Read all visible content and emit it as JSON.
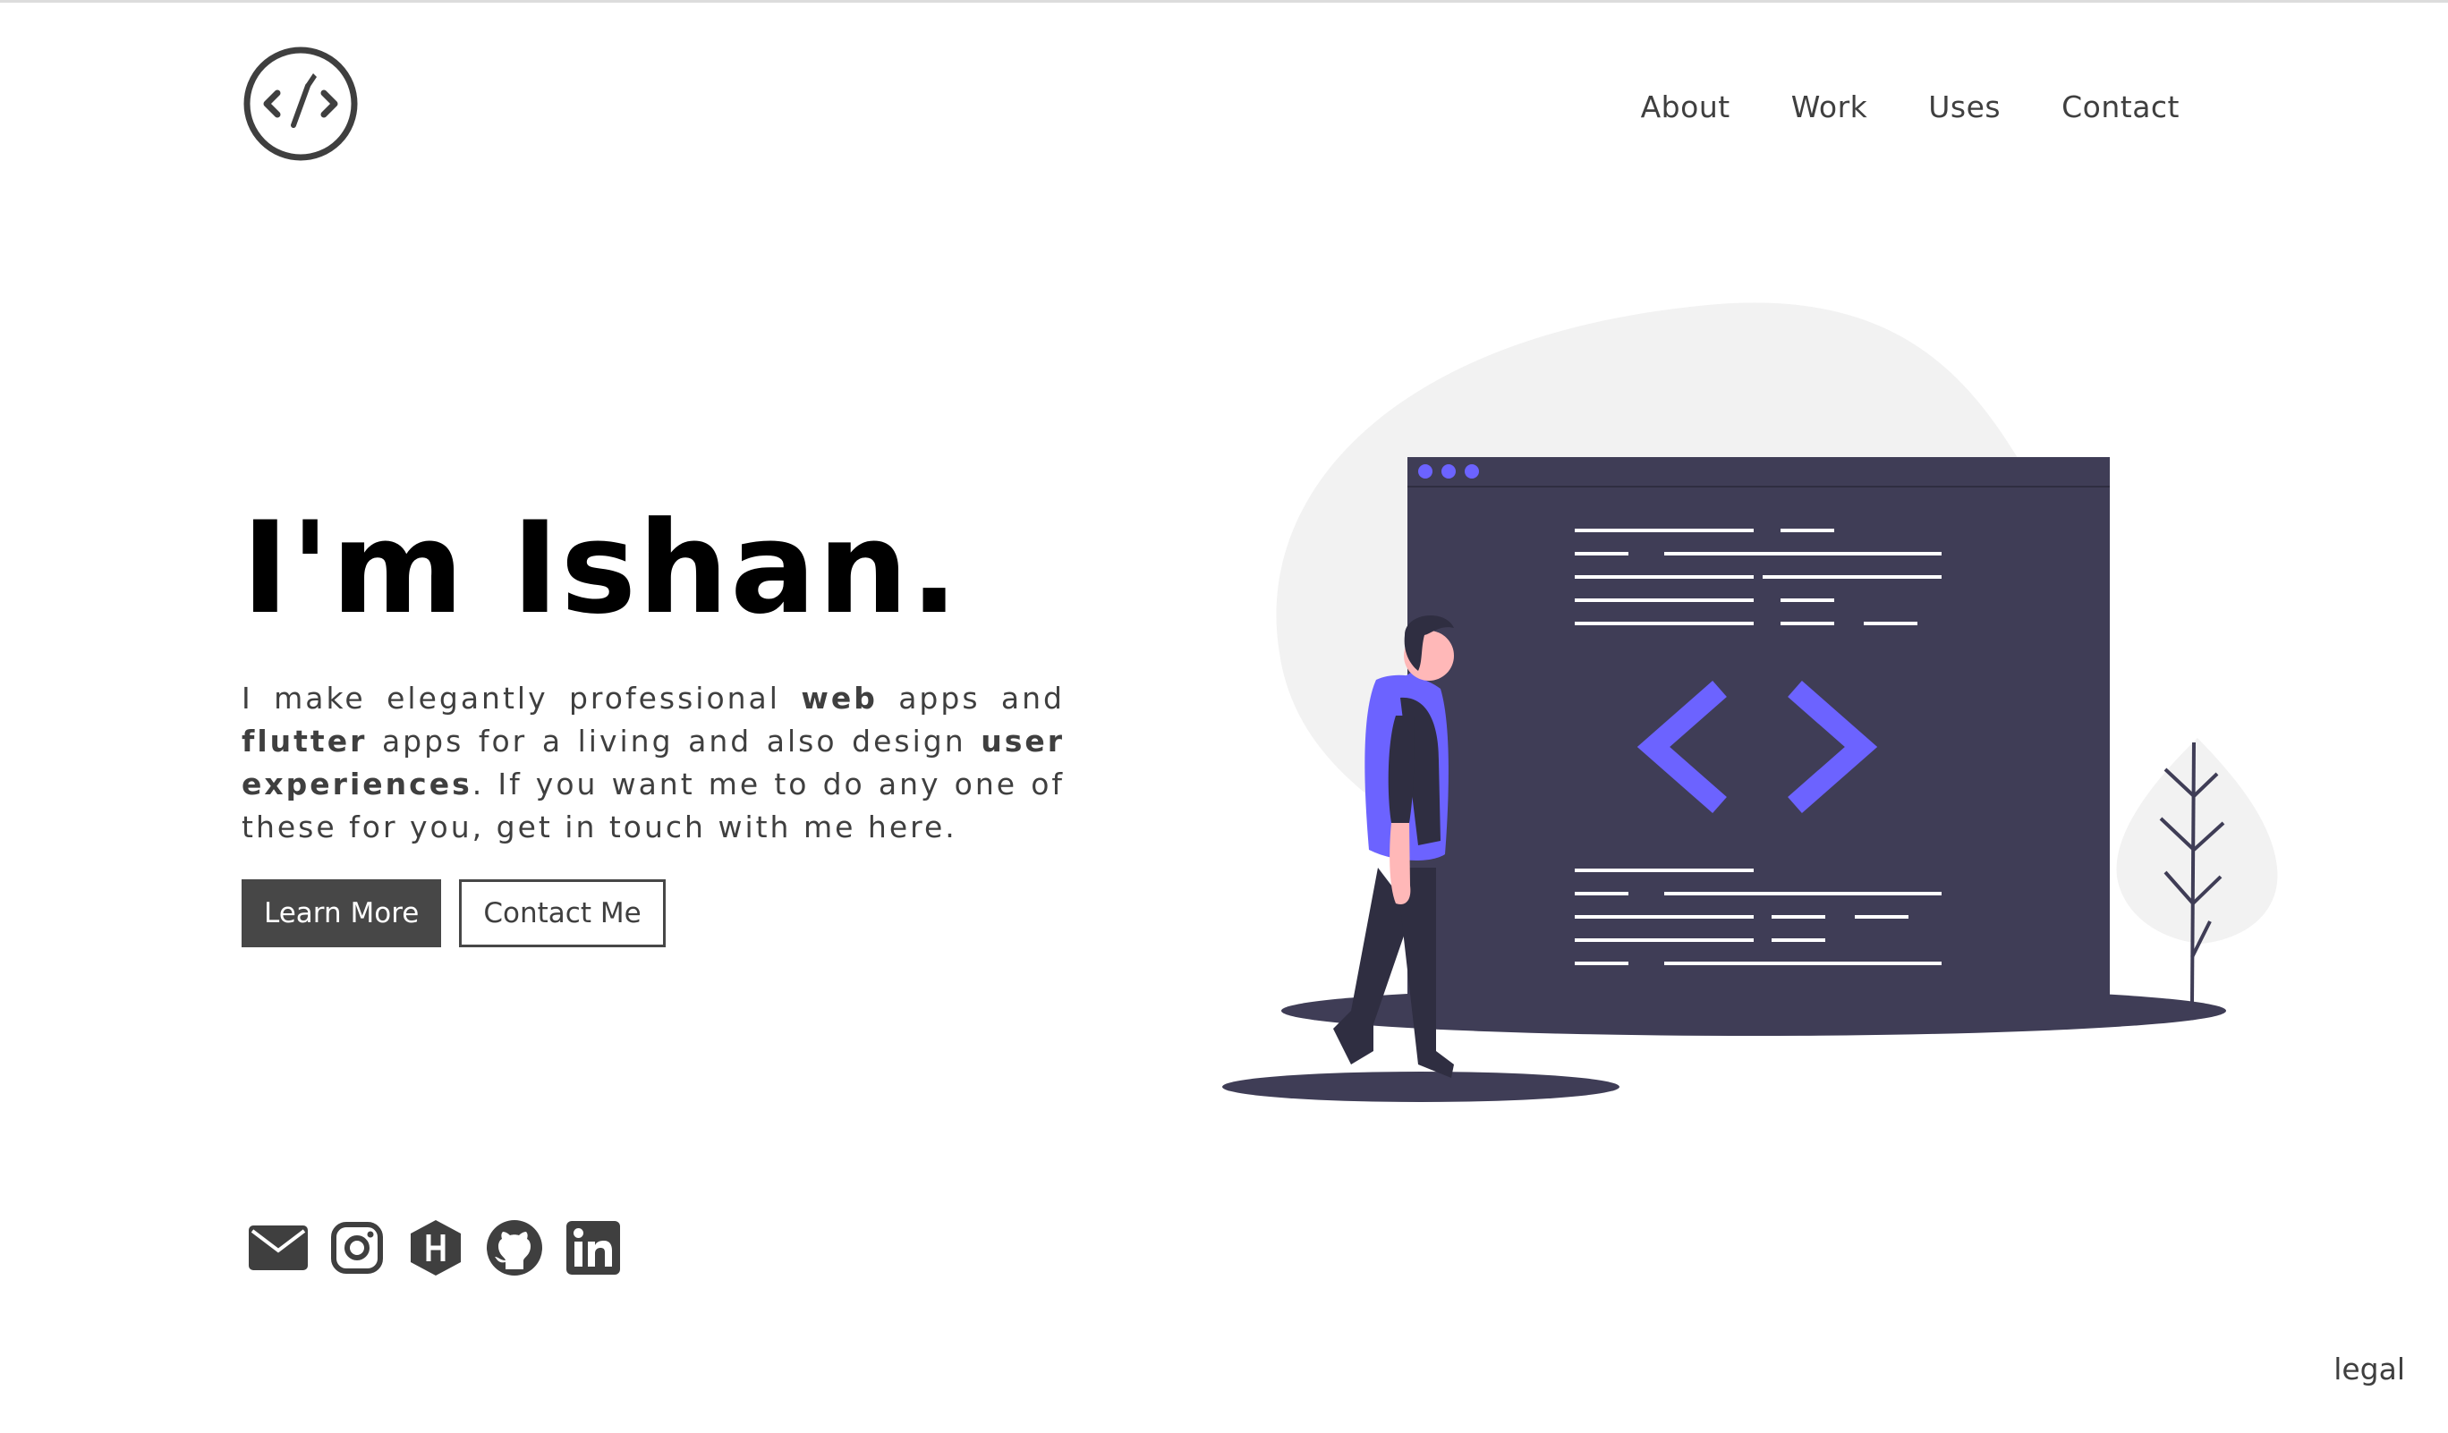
{
  "header": {
    "logo_icon": "code-brush-logo",
    "nav": [
      {
        "label": "About"
      },
      {
        "label": "Work"
      },
      {
        "label": "Uses"
      },
      {
        "label": "Contact"
      }
    ]
  },
  "hero": {
    "title": "I'm Ishan.",
    "desc": {
      "t1": "I make elegantly professional ",
      "b1": "web",
      "t2": " apps and ",
      "b2": "flutter",
      "t3": " apps for a living and also design ",
      "b3": "user experiences",
      "t4": ". If you want me to do any one of these for you, get in touch with me here."
    },
    "learn_more": "Learn More",
    "contact_me": "Contact Me"
  },
  "social": [
    {
      "icon": "email-icon"
    },
    {
      "icon": "instagram-icon"
    },
    {
      "icon": "hashnode-icon"
    },
    {
      "icon": "github-icon"
    },
    {
      "icon": "linkedin-icon"
    }
  ],
  "footer": {
    "legal": "legal"
  },
  "colors": {
    "accent": "#6c63ff",
    "dark": "#3f3d56",
    "button": "#474747",
    "blob": "#f2f2f2"
  }
}
